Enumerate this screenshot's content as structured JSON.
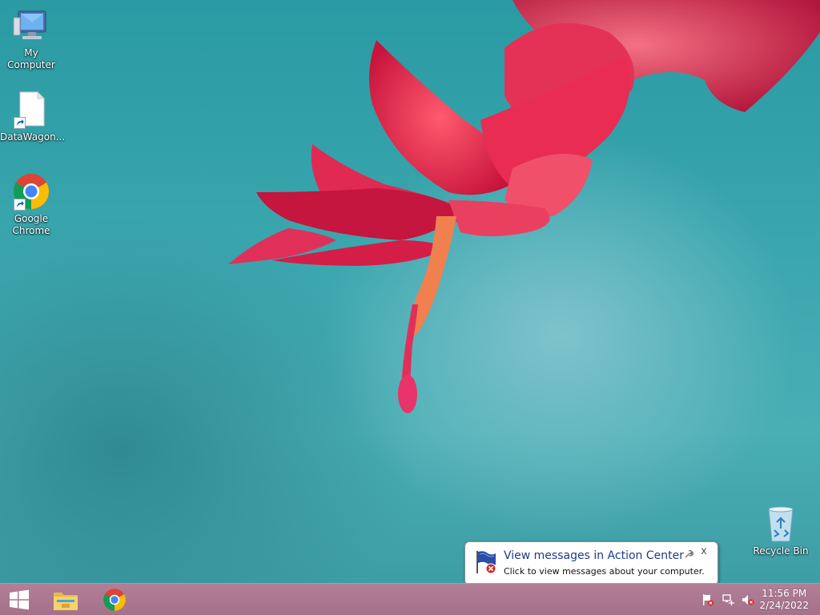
{
  "desktop": {
    "icons": [
      {
        "label": "My Computer",
        "icon": "computer-icon"
      },
      {
        "label": "DataWagon...",
        "icon": "blank-file-icon"
      },
      {
        "label": "Google Chrome",
        "icon": "chrome-icon"
      },
      {
        "label": "Recycle Bin",
        "icon": "recycle-bin-icon"
      }
    ],
    "wallpaper": "red-cactus-flower"
  },
  "notification": {
    "title": "View messages in Action Center",
    "body": "Click to view messages about your computer.",
    "close_glyph": "x",
    "icon": "action-center-flag-icon"
  },
  "taskbar": {
    "pinned": [
      {
        "name": "start-button",
        "icon": "windows-logo-icon"
      },
      {
        "name": "file-explorer",
        "icon": "folder-icon"
      },
      {
        "name": "google-chrome",
        "icon": "chrome-icon"
      }
    ],
    "tray": {
      "icons": [
        "action-center-flag-icon",
        "network-icon",
        "volume-muted-icon"
      ]
    },
    "clock": {
      "time": "11:56 PM",
      "date": "2/24/2022"
    }
  },
  "colors": {
    "taskbar": "#a8758e",
    "wallpaper_base": "#3aa6ae",
    "flower": "#e0264e",
    "balloon_title": "#1e3a8a"
  }
}
